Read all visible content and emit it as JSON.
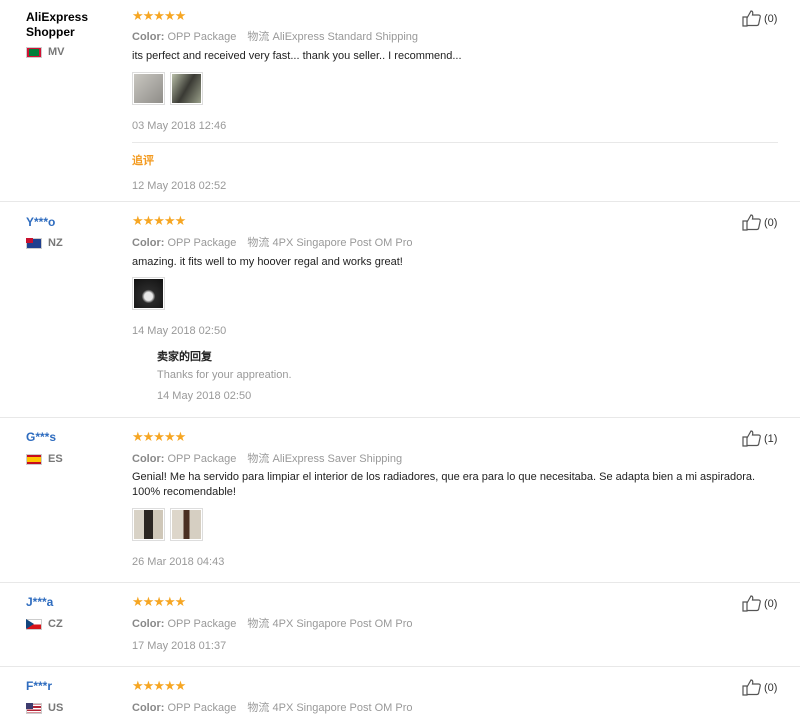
{
  "reviews": [
    {
      "user": "AliExpress Shopper",
      "country": "MV",
      "color_label": "Color:",
      "color_value": "OPP Package",
      "ship_label": "物流",
      "ship_value": "AliExpress Standard Shipping",
      "text": "its perfect and received very fast... thank you seller.. I recommend...",
      "date": "03 May 2018 12:46",
      "followup_label": "追评",
      "followup_date": "12 May 2018 02:52",
      "likes": "(0)",
      "rating": "★★★★★"
    },
    {
      "user": "Y***o",
      "country": "NZ",
      "color_label": "Color:",
      "color_value": "OPP Package",
      "ship_label": "物流",
      "ship_value": "4PX Singapore Post OM Pro",
      "text": "amazing. it fits well to my hoover regal and works great!",
      "date": "14 May 2018 02:50",
      "reply_title": "卖家的回复",
      "reply_text": "Thanks for your appreation.",
      "reply_date": "14 May 2018 02:50",
      "likes": "(0)",
      "rating": "★★★★★"
    },
    {
      "user": "G***s",
      "country": "ES",
      "color_label": "Color:",
      "color_value": "OPP Package",
      "ship_label": "物流",
      "ship_value": "AliExpress Saver Shipping",
      "text": "Genial! Me ha servido para limpiar el interior de los radiadores, que era para lo que necesitaba. Se adapta bien a mi aspiradora. 100% recomendable!",
      "date": "26 Mar 2018 04:43",
      "likes": "(1)",
      "rating": "★★★★★"
    },
    {
      "user": "J***a",
      "country": "CZ",
      "color_label": "Color:",
      "color_value": "OPP Package",
      "ship_label": "物流",
      "ship_value": "4PX Singapore Post OM Pro",
      "date": "17 May 2018 01:37",
      "likes": "(0)",
      "rating": "★★★★★"
    },
    {
      "user": "F***r",
      "country": "US",
      "color_label": "Color:",
      "color_value": "OPP Package",
      "ship_label": "物流",
      "ship_value": "4PX Singapore Post OM Pro",
      "likes": "(0)",
      "rating": "★★★★★"
    }
  ],
  "colors": {
    "star": "#f6a623",
    "username": "#2e6cbf",
    "followup": "#f39a1e"
  }
}
